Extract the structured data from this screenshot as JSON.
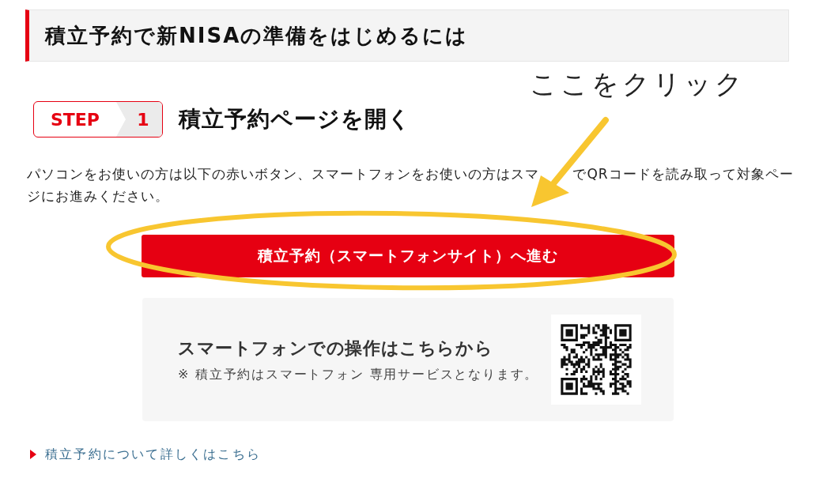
{
  "section": {
    "title": "積立予約で新NISAの準備をはじめるには"
  },
  "annotation": {
    "label": "ここをクリック"
  },
  "step": {
    "badge_label": "STEP",
    "number": "1",
    "title": "積立予約ページを開く"
  },
  "instructions": "パソコンをお使いの方は以下の赤いボタン、スマートフォンをお使いの方はスマ でQRコードを読み取って対象ページにお進みください。",
  "primary_button": {
    "label": "積立予約（スマートフォンサイト）へ進む"
  },
  "qr_card": {
    "title": "スマートフォンでの操作はこちらから",
    "note": "※ 積立予約はスマートフォン 専用サービスとなります。"
  },
  "link": {
    "label": "積立予約について詳しくはこちら"
  }
}
